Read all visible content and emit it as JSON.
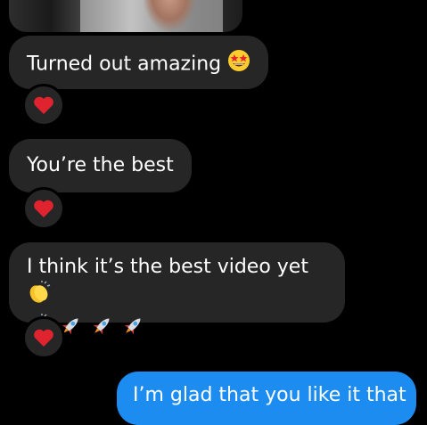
{
  "messages": [
    {
      "text": "Turned out amazing",
      "emoji": "star-struck",
      "reaction": "red-heart"
    },
    {
      "text": "You’re the best",
      "reaction": "red-heart"
    },
    {
      "text": "I think it’s the best video yet",
      "emoji_line": "clap clap rocket rocket rocket",
      "reaction": "red-heart"
    }
  ],
  "outgoing": {
    "text": "I’m glad that you like it that"
  },
  "colors": {
    "background": "#000000",
    "received_bubble": "#262626",
    "sent_bubble": "#1d8cf0",
    "heart": "#e0242f"
  }
}
